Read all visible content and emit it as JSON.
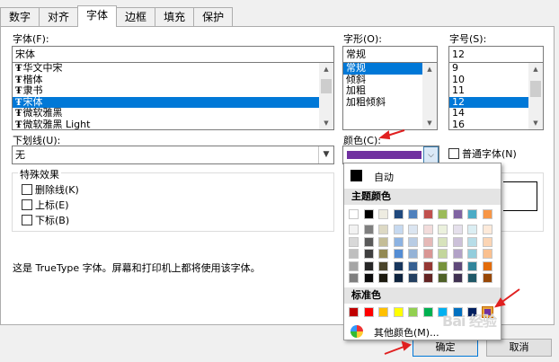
{
  "tabs": [
    "数字",
    "对齐",
    "字体",
    "边框",
    "填充",
    "保护"
  ],
  "active_tab": 2,
  "font": {
    "label": "字体(F):",
    "value": "宋体",
    "items": [
      "华文中宋",
      "楷体",
      "隶书",
      "宋体",
      "微软雅黑",
      "微软雅黑 Light"
    ],
    "selected": 3
  },
  "style": {
    "label": "字形(O):",
    "value": "常规",
    "items": [
      "常规",
      "倾斜",
      "加粗",
      "加粗倾斜"
    ],
    "selected": 0
  },
  "size": {
    "label": "字号(S):",
    "value": "12",
    "items": [
      "9",
      "10",
      "11",
      "12",
      "14",
      "16"
    ],
    "selected": 3
  },
  "underline": {
    "label": "下划线(U):",
    "value": "无"
  },
  "color": {
    "label": "颜色(C):",
    "value_color": "#7030a0"
  },
  "normal_font": {
    "label": "普通字体(N)"
  },
  "effects": {
    "title": "特殊效果",
    "items": [
      "删除线(K)",
      "上标(E)",
      "下标(B)"
    ]
  },
  "info_text": "这是 TrueType 字体。屏幕和打印机上都将使用该字体。",
  "buttons": {
    "ok": "确定",
    "cancel": "取消"
  },
  "dropdown": {
    "auto_label": "自动",
    "theme_header": "主题颜色",
    "standard_header": "标准色",
    "more_label": "其他颜色(M)...",
    "theme_base": [
      "#ffffff",
      "#000000",
      "#eeece1",
      "#1f497d",
      "#4f81bd",
      "#c0504d",
      "#9bbb59",
      "#8064a2",
      "#4bacc6",
      "#f79646"
    ],
    "theme_shades": [
      [
        "#f2f2f2",
        "#7f7f7f",
        "#ddd9c4",
        "#c6d9f0",
        "#dbe5f1",
        "#f2dcdb",
        "#ebf1dd",
        "#e5e0ec",
        "#dbeef3",
        "#fdeada"
      ],
      [
        "#d8d8d8",
        "#595959",
        "#c4bd97",
        "#8db3e2",
        "#b8cce4",
        "#e5b9b7",
        "#d7e3bc",
        "#ccc1d9",
        "#b7dde8",
        "#fbd5b5"
      ],
      [
        "#bfbfbf",
        "#3f3f3f",
        "#938953",
        "#548dd4",
        "#95b3d7",
        "#d99694",
        "#c3d69b",
        "#b2a2c7",
        "#92cddc",
        "#fac08f"
      ],
      [
        "#a5a5a5",
        "#262626",
        "#494429",
        "#17365d",
        "#366092",
        "#953734",
        "#76923c",
        "#5f497a",
        "#31859b",
        "#e36c09"
      ],
      [
        "#7f7f7f",
        "#0c0c0c",
        "#1d1b10",
        "#0f243e",
        "#244061",
        "#632423",
        "#4f6128",
        "#3f3151",
        "#205867",
        "#974806"
      ]
    ],
    "standard": [
      "#c00000",
      "#ff0000",
      "#ffc000",
      "#ffff00",
      "#92d050",
      "#00b050",
      "#00b0f0",
      "#0070c0",
      "#002060",
      "#7030a0"
    ],
    "standard_selected": 9
  },
  "watermark": "Bai 经验"
}
